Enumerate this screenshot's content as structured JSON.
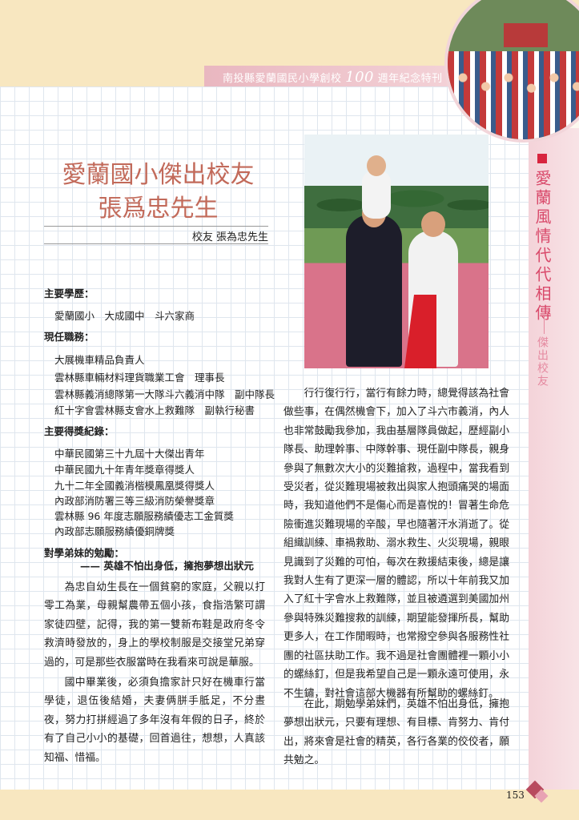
{
  "header": {
    "prefix": "南投縣愛蘭國民小學創校",
    "number": "100",
    "suffix": "週年紀念特刊"
  },
  "side": {
    "title": "愛蘭風情代代相傳",
    "subtitle": "傑出校友"
  },
  "title": {
    "line1": "愛蘭國小傑出校友",
    "line2": "張爲忠先生"
  },
  "byline": {
    "label": "校友",
    "name": "張為忠先生"
  },
  "sections": {
    "education": {
      "heading": "主要學歷：",
      "items": [
        "愛蘭國小　大成國中　斗六家商"
      ]
    },
    "positions": {
      "heading": "現任職務：",
      "items": [
        "大展機車精品負責人",
        "雲林縣車輛材料理貨職業工會　理事長",
        "雲林縣義消總隊第一大隊斗六義消中隊　副中隊長",
        "紅十字會雲林縣支會水上救難隊　副執行秘書"
      ]
    },
    "awards": {
      "heading": "主要得獎紀錄：",
      "items": [
        "中華民國第三十九屆十大傑出青年",
        "中華民國九十年青年獎章得獎人",
        "九十二年全國義消楷模鳳凰獎得獎人",
        "內政部消防署三等三級消防榮譽獎章",
        "雲林縣 96 年度志願服務績優志工金質獎",
        "內政部志願服務績優銅牌獎"
      ]
    },
    "advice": {
      "heading": "對學弟妹的勉勵：",
      "quote": "—— 英雄不怕出身低，擁抱夢想出狀元"
    }
  },
  "paragraphs": {
    "p1": "為忠自幼生長在一個貧窮的家庭，父親以打零工為業，母親幫農帶五個小孩，食指浩繁可謂家徒四壁，記得，我的第一雙新布鞋是政府冬令救濟時發放的，身上的學校制服是交接堂兄弟穿過的，可是那些衣服當時在我看來可說是華服。",
    "p2": "國中畢業後，必須負擔家計只好在機車行當學徒，退伍後結婚，夫妻俩胼手胝足，不分晝夜，努力打拼經過了多年沒有年假的日子，終於有了自己小小的基礎，回首過往，想想，人真該知福、惜福。",
    "p3": "行行復行行，當行有餘力時，總覺得該為社會做些事，在偶然機會下，加入了斗六市義消，內人也非常鼓勵我參加，我由基層隊員做起，歷經副小隊長、助理幹事、中隊幹事、現任副中隊長，親身參與了無數次大小的災難搶救，過程中，當我看到受災者，從災難現場被救出與家人抱頭痛哭的場面時，我知道他們不是傷心而是喜悅的！冒著生命危險衝進災難現場的辛酸，早也隨著汗水消逝了。從組織訓練、車禍救助、溺水救生、火災現場，親眼見識到了災難的可怕，每次在救援結束後，總是讓我對人生有了更深一層的體認，所以十年前我又加入了紅十字會水上救難隊，並且被遴選到美國加州參與特殊災難搜救的訓練，期望能發揮所長，幫助更多人，在工作閒暇時，也常撥空參與各服務性社團的社區扶助工作。我不過是社會團體裡一顆小小的螺絲釘，但是我希望自己是一顆永遠可使用，永不生鏽，對社會這部大機器有所幫助的螺絲釘。",
    "p4": "在此，期勉學弟妹們，英雄不怕出身低，擁抱夢想出狀元，只要有理想、有目標、肯努力、肯付出，將來會是社會的精英，各行各業的佼佼者，願共勉之。"
  },
  "page_number": "153",
  "colors": {
    "title": "#c26a5a",
    "accent": "#d94a6b",
    "band": "#f8e7c0"
  }
}
